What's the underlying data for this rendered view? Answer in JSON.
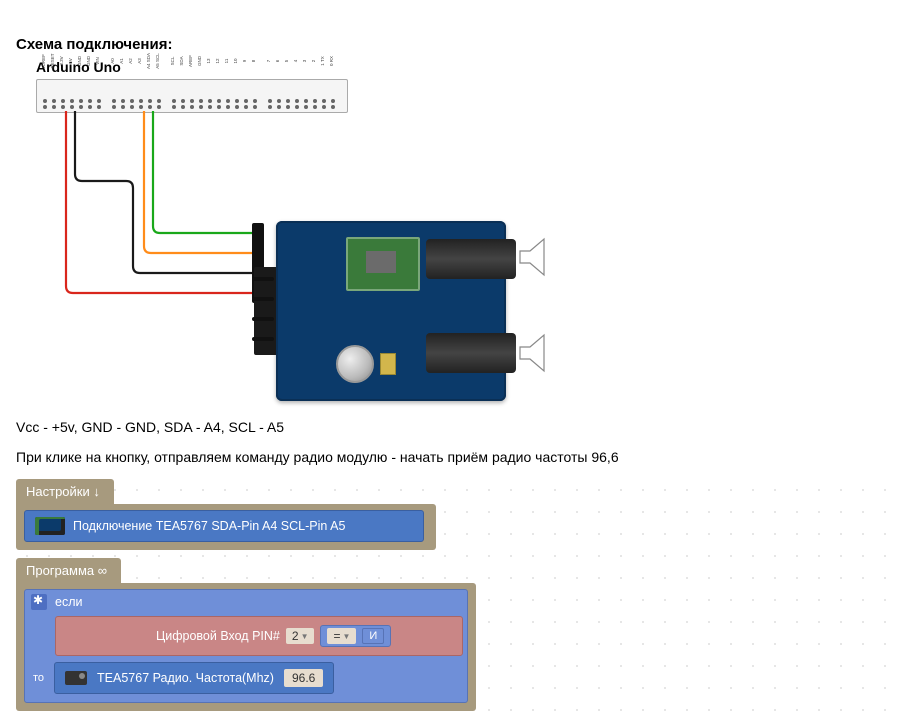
{
  "title": "Схема подключения:",
  "board_label": "Arduino Uno",
  "pins": [
    "IOREF",
    "RESET",
    "3.3V",
    "5V",
    "GND",
    "GND",
    "VIN",
    "",
    "A0",
    "A1",
    "A2",
    "A3",
    "A4 SDA",
    "A5 SCL",
    "",
    "SCL",
    "SDA",
    "AREF",
    "GND",
    "13",
    "12",
    "11",
    "10",
    "9",
    "8",
    "",
    "7",
    "6",
    "5",
    "4",
    "3",
    "2",
    "1 TX",
    "0 RX"
  ],
  "wiring_text": "Vcc - +5v, GND - GND, SDA - A4, SCL - A5",
  "description": "При клике на кнопку, отправляем команду радио модулю - начать приём  радио частоты 96,6",
  "blocks": {
    "settings_label": "Настройки ↓",
    "tea_setup": "Подключение TEA5767 SDA-Pin A4 SCL-Pin A5",
    "program_label": "Программа ∞",
    "if_label": "если",
    "digital_in_label": "Цифровой Вход PIN#",
    "digital_pin": "2",
    "op": "=",
    "true_label": "И",
    "then_label": "то",
    "freq_label": "TEA5767  Радио.  Частота(Mhz)",
    "freq_value": "96.6"
  },
  "wire_colors": {
    "vcc": "#d9261c",
    "gnd": "#1a1a1a",
    "sda": "#ff8c1a",
    "scl": "#1aa81a"
  }
}
